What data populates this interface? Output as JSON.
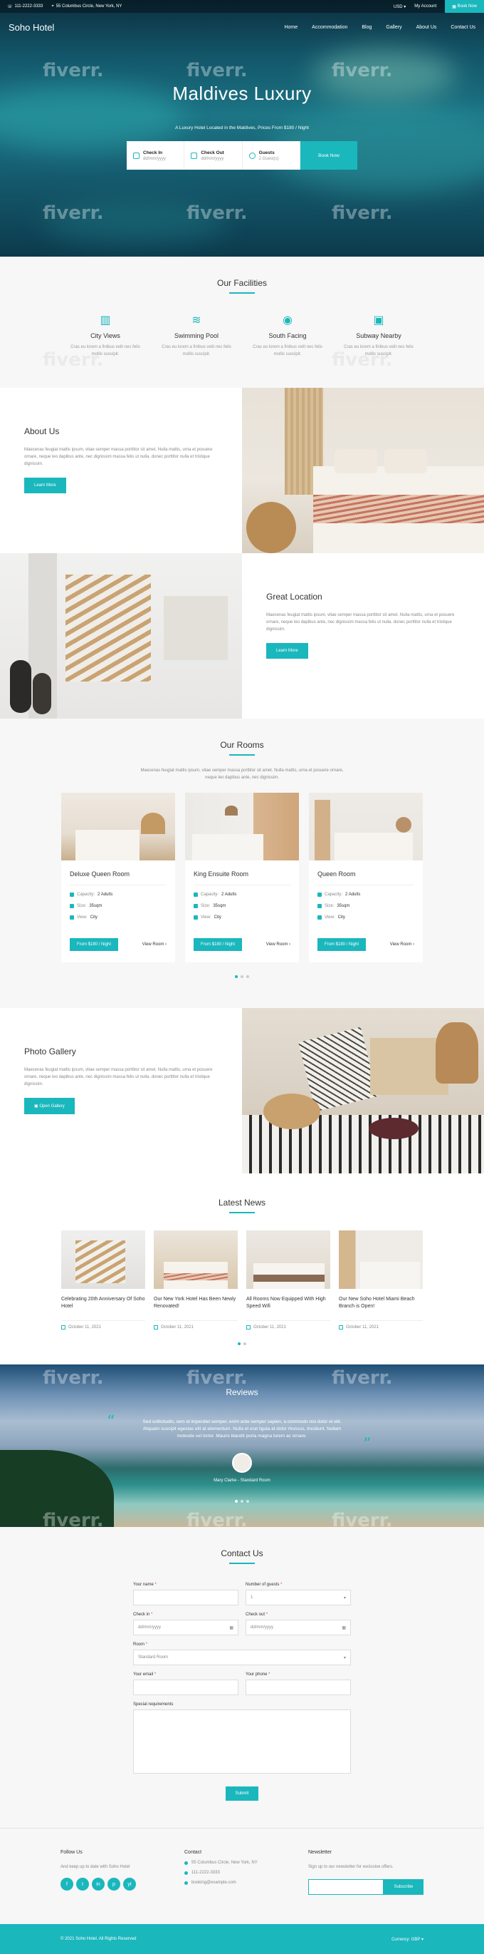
{
  "topbar": {
    "phone": "111-2222-3333",
    "address": "55 Columbus Circle, New York, NY",
    "currency": "USD",
    "account": "My Account",
    "book_now": "Book Now"
  },
  "nav": {
    "logo": "Soho Hotel",
    "links": [
      "Home",
      "Accommodation",
      "Blog",
      "Gallery",
      "About Us",
      "Contact Us"
    ]
  },
  "hero": {
    "title": "Maldives Luxury",
    "tagline": "A Luxury Hotel Located in the Maldives, Prices From $180 / Night",
    "booking": {
      "checkin_label": "Check In",
      "checkin_value": "dd/mm/yyyy",
      "checkout_label": "Check Out",
      "checkout_value": "dd/mm/yyyy",
      "guests_label": "Guests",
      "guests_value": "2 Guest(s)",
      "button": "Book Now"
    }
  },
  "watermark": "fiverr.",
  "facilities": {
    "title": "Our Facilities",
    "items": [
      {
        "name": "City Views",
        "icon": "building-icon",
        "desc": "Cras eu lorem a finibus velit nec felis mollis suscipit."
      },
      {
        "name": "Swimming Pool",
        "icon": "pool-icon",
        "desc": "Cras eu lorem a finibus velit nec felis mollis suscipit."
      },
      {
        "name": "South Facing",
        "icon": "compass-icon",
        "desc": "Cras eu lorem a finibus velit nec felis mollis suscipit."
      },
      {
        "name": "Subway Nearby",
        "icon": "subway-icon",
        "desc": "Cras eu lorem a finibus velit nec felis mollis suscipit."
      }
    ]
  },
  "about": {
    "title": "About Us",
    "text": "Maecenas feugiat mattis ipsum, vitae semper massa porttitor sit amet. Nulla mattis, urna et posuere ornare, neque leo dapibus ante, nec dignissim massa felis ut nulla. donec porttitor nulla et tristique dignissim.",
    "button": "Learn More"
  },
  "location": {
    "title": "Great Location",
    "text": "Maecenas feugiat mattis ipsum, vitae semper massa porttitor sit amet. Nulla mattis, urna et posuere ornare, neque leo dapibus ante, nec dignissim massa felis ut nulla. donec porttitor nulla et tristique dignissim.",
    "button": "Learn More"
  },
  "rooms": {
    "title": "Our Rooms",
    "intro": "Maecenas feugiat mattis ipsum, vitae semper massa porttitor sit amet. Nulla mattis, urna et posuere ornare, neque leo dapibus ante, nec dignissim.",
    "capacity_label": "Capacity:",
    "size_label": "Size:",
    "view_label": "View:",
    "items": [
      {
        "name": "Deluxe Queen Room",
        "capacity": "2 Adults",
        "size": "35sqm",
        "view": "City",
        "price": "From $180 / Night",
        "link": "View Room"
      },
      {
        "name": "King Ensuite Room",
        "capacity": "2 Adults",
        "size": "35sqm",
        "view": "City",
        "price": "From $180 / Night",
        "link": "View Room"
      },
      {
        "name": "Queen Room",
        "capacity": "2 Adults",
        "size": "35sqm",
        "view": "City",
        "price": "From $180 / Night",
        "link": "View Room"
      }
    ]
  },
  "gallery": {
    "title": "Photo Gallery",
    "text": "Maecenas feugiat mattis ipsum, vitae semper massa porttitor sit amet. Nulla mattis, urna et posuere ornare, neque leo dapibus ante, nec dignissim massa felis ut nulla. donec porttitor nulla et tristique dignissim.",
    "button": "Open Gallery"
  },
  "news": {
    "title": "Latest News",
    "items": [
      {
        "title": "Celebrating 20th Anniversary Of Soho Hotel",
        "date": "October 11, 2021"
      },
      {
        "title": "Our New York Hotel Has Been Newly Renovated!",
        "date": "October 11, 2021"
      },
      {
        "title": "All Rooms Now Equipped With High Speed Wifi",
        "date": "October 11, 2021"
      },
      {
        "title": "Our New Soho Hotel Miami Beach Branch is Open!",
        "date": "October 11, 2021"
      }
    ]
  },
  "reviews": {
    "title": "Reviews",
    "quote": "Sed sollicitudin, sem id imperdiet semper, enim ante semper sapien, a commodo nisi dolor et elit. Aliquam suscipit egestas elit at elementum. Nulla et erat ligula at dolor rhoncus, tincidunt. Nullam molestie vel tortor. Mauris blandit porta magna lorem ac ornare.",
    "author": "Mary Clarke - Standard Room"
  },
  "contact": {
    "title": "Contact Us",
    "fields": {
      "name": "Your name",
      "guests": "Number of guests",
      "guests_value": "1",
      "checkin": "Check in",
      "checkin_value": "dd/mm/yyyy",
      "checkout": "Check out",
      "checkout_value": "dd/mm/yyyy",
      "room": "Room",
      "room_value": "Standard Room",
      "email": "Your email",
      "phone": "Your phone",
      "special": "Special requirements"
    },
    "required": "*",
    "submit": "Submit"
  },
  "footer": {
    "follow_title": "Follow Us",
    "follow_text": "And keep up to date with Soho Hotel",
    "social": [
      "f",
      "t",
      "in",
      "p",
      "yt"
    ],
    "contact_title": "Contact",
    "contact_address": "55 Columbus Circle, New York, NY",
    "contact_phone": "111-2222-3333",
    "contact_email": "booking@example.com",
    "newsletter_title": "Newsletter",
    "newsletter_text": "Sign up to our newsletter for exclusive offers.",
    "subscribe": "Subscribe",
    "copyright": "© 2021 Soho Hotel. All Rights Reserved",
    "currency": "Currency: GBP"
  },
  "colors": {
    "accent": "#1ab7bd"
  }
}
